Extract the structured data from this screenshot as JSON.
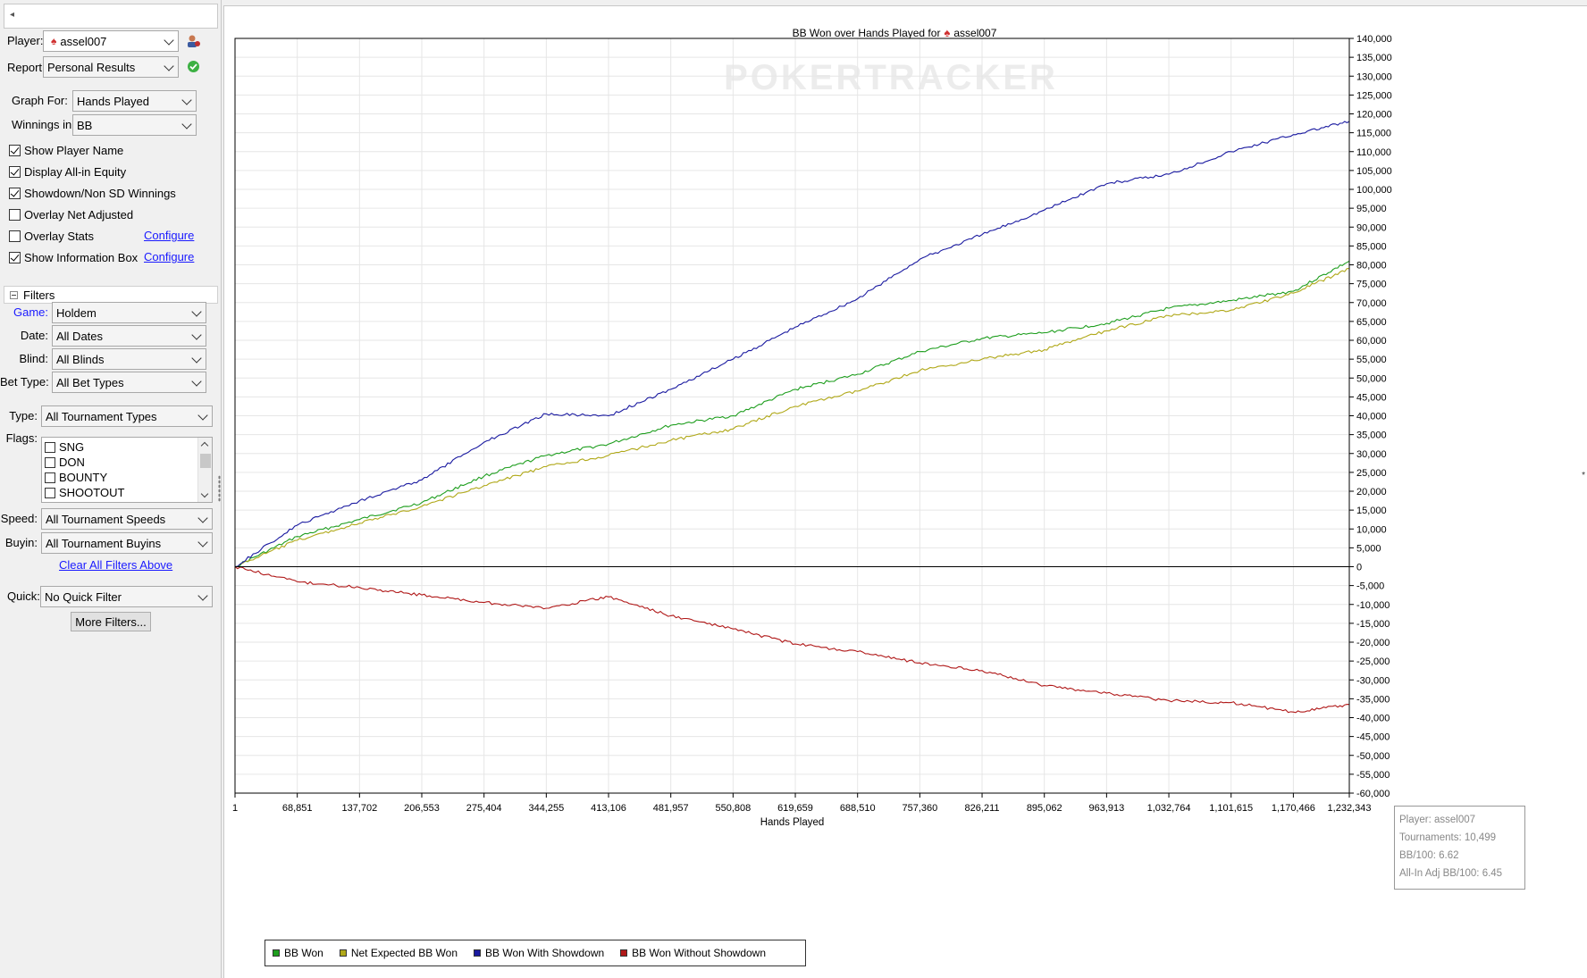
{
  "sidebar": {
    "player_label": "Player:",
    "player_value": "assel007",
    "report_label": "Report:",
    "report_value": "Personal Results",
    "graph_for_label": "Graph For:",
    "graph_for_value": "Hands Played",
    "winnings_label": "Winnings in:",
    "winnings_value": "BB",
    "options": [
      {
        "label": "Show Player Name",
        "checked": true
      },
      {
        "label": "Display All-in Equity",
        "checked": true
      },
      {
        "label": "Showdown/Non SD Winnings",
        "checked": true
      },
      {
        "label": "Overlay Net Adjusted",
        "checked": false
      },
      {
        "label": "Overlay Stats",
        "checked": false
      },
      {
        "label": "Show Information Box",
        "checked": true
      }
    ],
    "configure_label": "Configure",
    "filters_header": "Filters",
    "game_label": "Game:",
    "game_value": "Holdem",
    "date_label": "Date:",
    "date_value": "All Dates",
    "blind_label": "Blind:",
    "blind_value": "All Blinds",
    "bet_type_label": "Bet Type:",
    "bet_type_value": "All Bet Types",
    "type_label": "Type:",
    "type_value": "All Tournament Types",
    "flags_label": "Flags:",
    "flags": [
      "SNG",
      "DON",
      "BOUNTY",
      "SHOOTOUT"
    ],
    "speed_label": "Speed:",
    "speed_value": "All Tournament Speeds",
    "buyin_label": "Buyin:",
    "buyin_value": "All Tournament Buyins",
    "clear_filters_label": "Clear All Filters Above",
    "quick_label": "Quick:",
    "quick_value": "No Quick Filter",
    "more_filters_label": "More Filters..."
  },
  "chart": {
    "title_prefix": "BB Won over Hands Played for",
    "title_player": "assel007",
    "watermark": "POKERTRACKER",
    "info_box": {
      "player": "Player: assel007",
      "tournaments": "Tournaments: 10,499",
      "bb100": "BB/100: 6.62",
      "allin_bb100": "All-In Adj BB/100: 6.45"
    },
    "legend": [
      {
        "label": "BB Won",
        "color": "#1e9e1e"
      },
      {
        "label": "Net Expected BB Won",
        "color": "#b0a818"
      },
      {
        "label": "BB Won With Showdown",
        "color": "#1a1aa0"
      },
      {
        "label": "BB Won Without Showdown",
        "color": "#b01818"
      }
    ]
  },
  "chart_data": {
    "type": "line",
    "title": "BB Won over Hands Played for assel007",
    "xlabel": "Hands Played",
    "ylabel": "",
    "xlim": [
      1,
      1232343
    ],
    "ylim": [
      -60000,
      140000
    ],
    "x_ticks": [
      "1",
      "68,851",
      "137,702",
      "206,553",
      "275,404",
      "344,255",
      "413,106",
      "481,957",
      "550,808",
      "619,659",
      "688,510",
      "757,360",
      "826,211",
      "895,062",
      "963,913",
      "1,032,764",
      "1,101,615",
      "1,170,466",
      "1,232,343"
    ],
    "x": [
      1,
      68851,
      137702,
      206553,
      275404,
      344255,
      413106,
      481957,
      550808,
      619659,
      688510,
      757360,
      826211,
      895062,
      963913,
      1032764,
      1101615,
      1170466,
      1232343
    ],
    "y_ticks": [
      "140,000",
      "135,000",
      "130,000",
      "125,000",
      "120,000",
      "115,000",
      "110,000",
      "105,000",
      "100,000",
      "95,000",
      "90,000",
      "85,000",
      "80,000",
      "75,000",
      "70,000",
      "65,000",
      "60,000",
      "55,000",
      "50,000",
      "45,000",
      "40,000",
      "35,000",
      "30,000",
      "25,000",
      "20,000",
      "15,000",
      "10,000",
      "5,000",
      "0",
      "-5,000",
      "-10,000",
      "-15,000",
      "-20,000",
      "-25,000",
      "-30,000",
      "-35,000",
      "-40,000",
      "-45,000",
      "-50,000",
      "-55,000",
      "-60,000"
    ],
    "grid": true,
    "legend_position": "bottom-left",
    "series": [
      {
        "name": "BB Won",
        "color": "#1e9e1e",
        "values": [
          0,
          8000,
          12500,
          17000,
          24000,
          29500,
          32500,
          37500,
          40000,
          47000,
          51000,
          57000,
          60500,
          62000,
          64500,
          68500,
          70500,
          73000,
          81000
        ]
      },
      {
        "name": "Net Expected BB Won",
        "color": "#b0a818",
        "values": [
          0,
          7000,
          11500,
          16000,
          21500,
          26500,
          29500,
          33500,
          36500,
          42500,
          46500,
          52000,
          55000,
          57500,
          62500,
          66500,
          68000,
          72500,
          79000
        ]
      },
      {
        "name": "BB Won With Showdown",
        "color": "#1a1aa0",
        "values": [
          0,
          11000,
          17500,
          23000,
          33000,
          40500,
          40000,
          47000,
          55000,
          63500,
          71000,
          81500,
          88000,
          94500,
          101500,
          104000,
          110000,
          114500,
          118000
        ]
      },
      {
        "name": "BB Won Without Showdown",
        "color": "#b01818",
        "values": [
          0,
          -4000,
          -5500,
          -7500,
          -9500,
          -11000,
          -8000,
          -13000,
          -16500,
          -20500,
          -22500,
          -25500,
          -27500,
          -31500,
          -33500,
          -35500,
          -36000,
          -38500,
          -36500
        ]
      }
    ]
  }
}
